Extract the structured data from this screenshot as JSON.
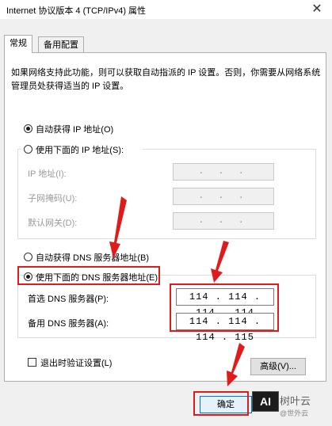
{
  "window": {
    "title": "Internet 协议版本 4 (TCP/IPv4) 属性",
    "close_glyph": "✕"
  },
  "tabs": [
    {
      "label": "常规",
      "active": true
    },
    {
      "label": "备用配置",
      "active": false
    }
  ],
  "description": "如果网络支持此功能，则可以获取自动指派的 IP 设置。否则，你需要从网络系统管理员处获得适当的 IP 设置。",
  "ip_section": {
    "auto_label": "自动获得 IP 地址(O)",
    "manual_label": "使用下面的 IP 地址(S):",
    "selected": "auto",
    "fields": [
      {
        "label": "IP 地址(I):",
        "value": ". . ."
      },
      {
        "label": "子网掩码(U):",
        "value": ". . ."
      },
      {
        "label": "默认网关(D):",
        "value": ". . ."
      }
    ]
  },
  "dns_section": {
    "auto_label": "自动获得 DNS 服务器地址(B)",
    "manual_label": "使用下面的 DNS 服务器地址(E):",
    "selected": "manual",
    "preferred_label": "首选 DNS 服务器(P):",
    "preferred_value": "114 . 114 . 114 . 114",
    "alternate_label": "备用 DNS 服务器(A):",
    "alternate_value": "114 . 114 . 114 . 115"
  },
  "validate_on_exit_label": "退出时验证设置(L)",
  "advanced_button": "高级(V)...",
  "ok_button": "确定",
  "annotation_color": "#e01b1b",
  "watermark": {
    "badge": "AI",
    "text": "树叶云",
    "sub": "@世外云"
  }
}
